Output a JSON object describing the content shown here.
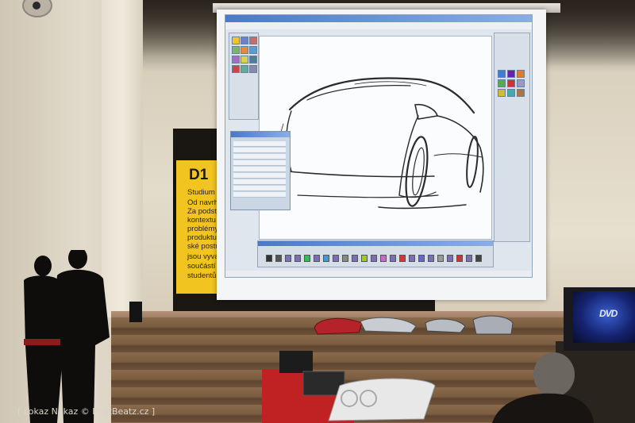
{
  "photo": {
    "description_tag": "presentation-hall-photo",
    "credit": "[ Lokaz Nokaz © PhatBeatz.cz ]"
  },
  "banner": {
    "title": "D1",
    "lines": [
      "Studium",
      "Od navrhe",
      "Za podsta",
      "kontextu",
      "problémy",
      "produktu,",
      "ské postu",
      "jsou vyva",
      "součástí",
      "studentů"
    ]
  },
  "tv": {
    "logo": "DVD"
  },
  "colors": {
    "banner_yellow": "#f2c420",
    "stand_red": "#c02224",
    "screen_white": "#f4f5f6",
    "sketch_stroke": "#2b2b2b"
  }
}
